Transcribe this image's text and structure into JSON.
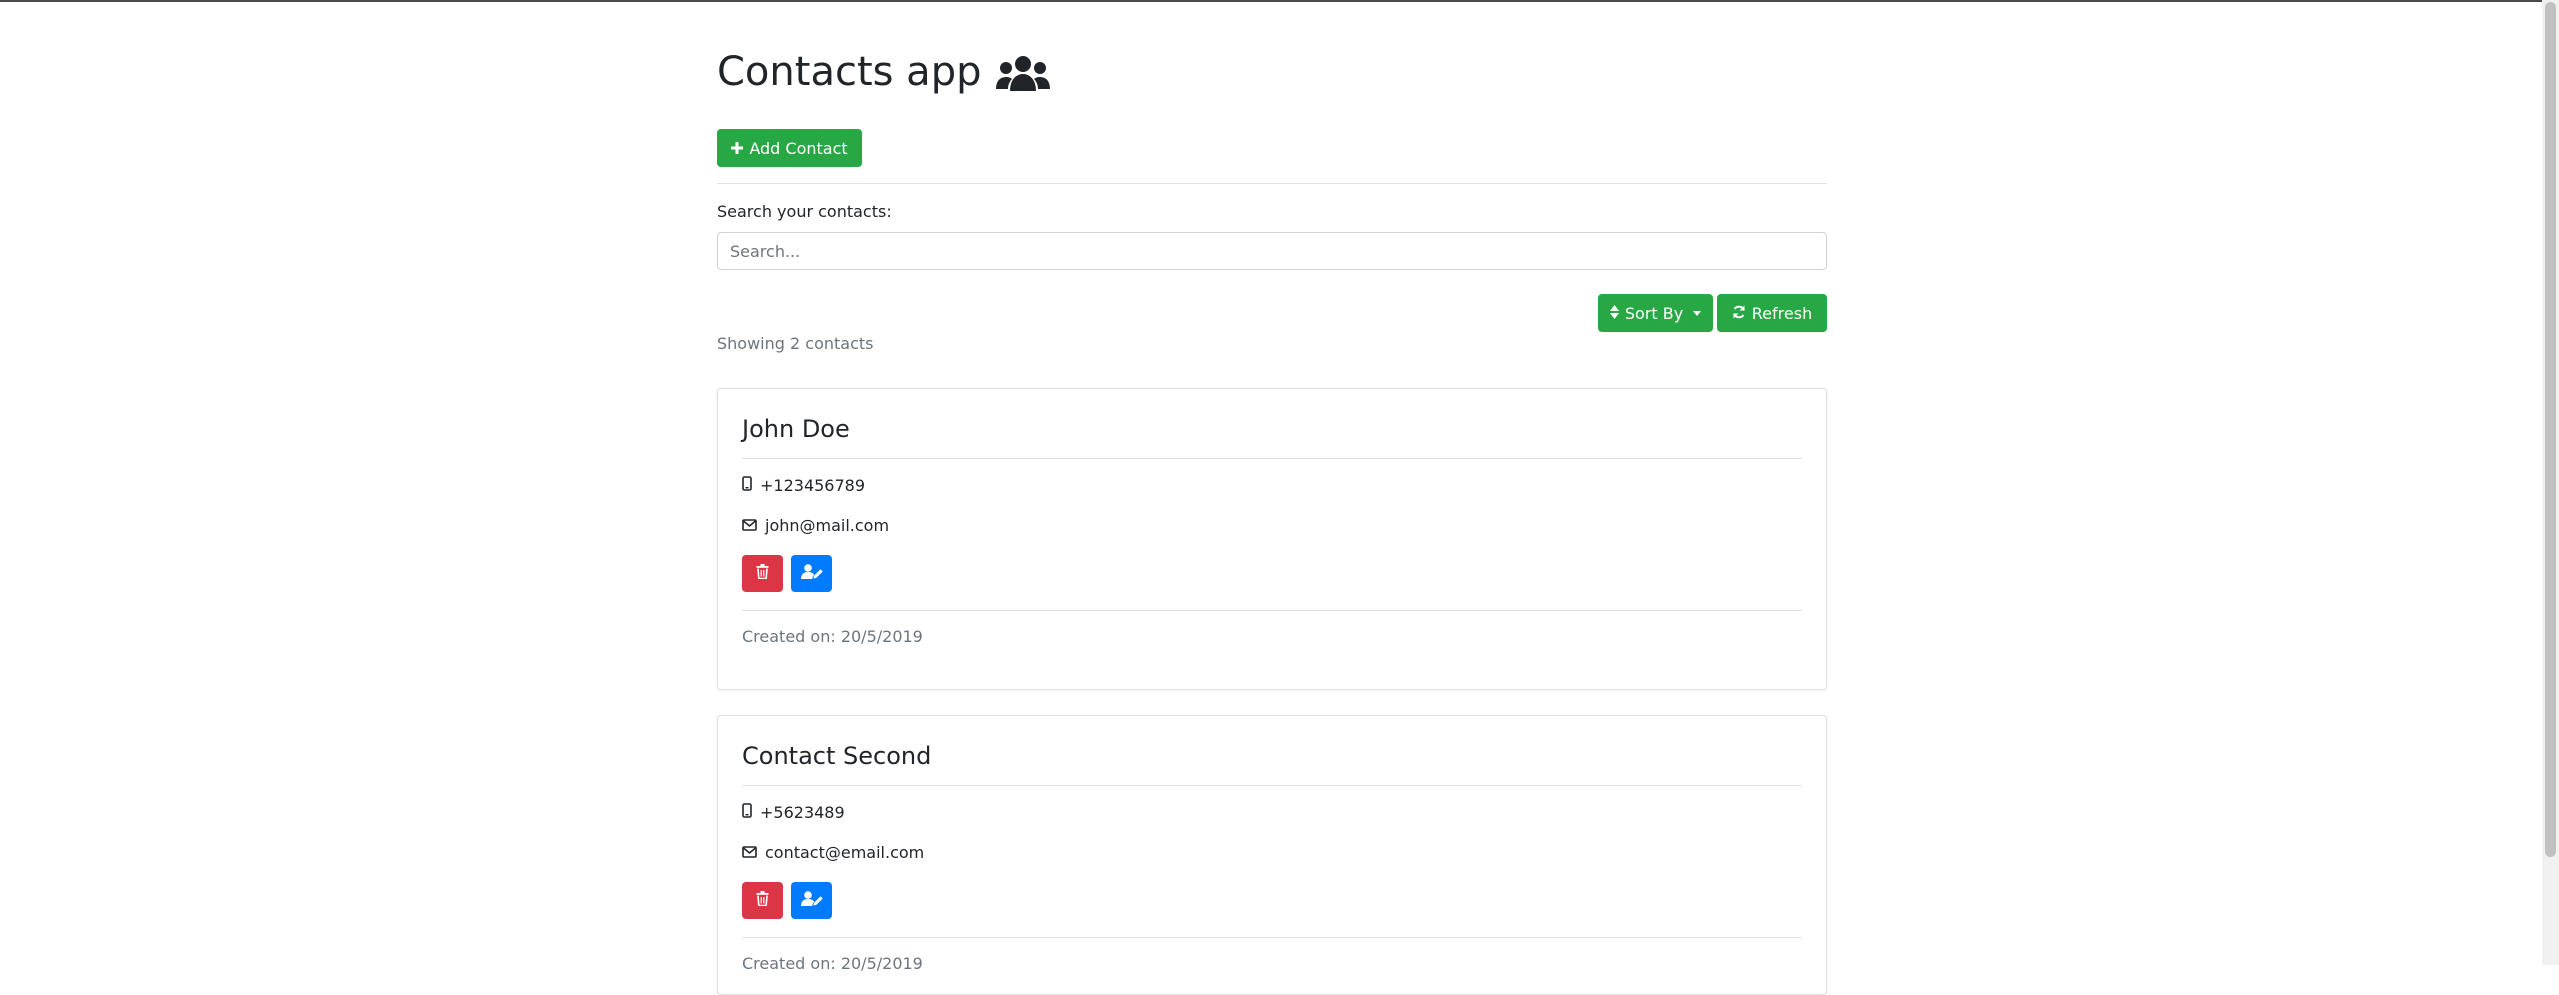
{
  "app": {
    "title": "Contacts app",
    "add_label": "Add Contact"
  },
  "search": {
    "label": "Search your contacts:",
    "placeholder": "Search...",
    "value": ""
  },
  "toolbar": {
    "sort_label": "Sort By",
    "refresh_label": "Refresh"
  },
  "summary": {
    "showing": "Showing 2 contacts"
  },
  "contacts": [
    {
      "name": "John Doe",
      "phone": "+123456789",
      "email": "john@mail.com",
      "created": "Created on: 20/5/2019"
    },
    {
      "name": "Contact Second",
      "phone": "+5623489",
      "email": "contact@email.com",
      "created": "Created on: 20/5/2019"
    }
  ],
  "colors": {
    "primary_green": "#28a745",
    "danger_red": "#dc3545",
    "edit_blue": "#007bff",
    "muted_text": "#6c757d"
  },
  "icons": {
    "title": "users-icon",
    "add": "plus-icon",
    "sort": "sort-icon",
    "refresh": "refresh-icon",
    "phone": "mobile-phone-icon",
    "email": "envelope-icon",
    "delete": "trash-icon",
    "edit": "user-edit-icon"
  }
}
